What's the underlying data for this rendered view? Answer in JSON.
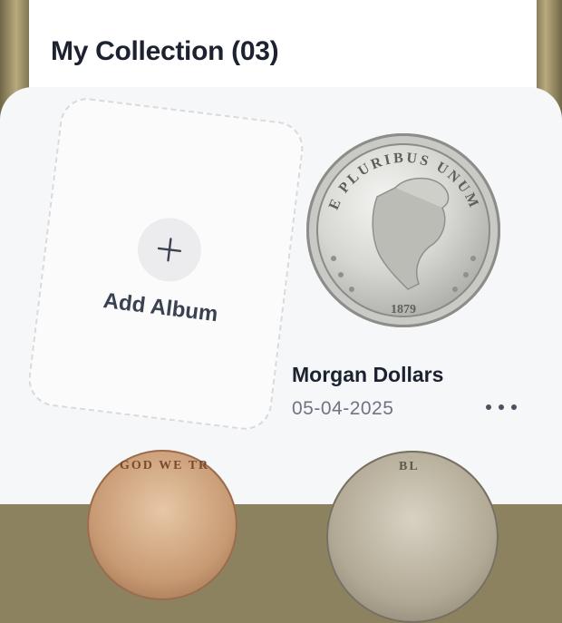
{
  "collection": {
    "title": "My Collection (03)"
  },
  "add_album": {
    "label": "Add Album"
  },
  "albums": [
    {
      "name": "Morgan Dollars",
      "date": "05-04-2025",
      "coin_inscription": "E PLURIBUS UNUM",
      "coin_year": "1879"
    }
  ],
  "partial_coins": [
    {
      "inscription": "GOD WE TR"
    },
    {
      "inscription": "BL"
    }
  ],
  "icons": {
    "add": "plus-icon",
    "more": "more-horizontal-icon"
  }
}
